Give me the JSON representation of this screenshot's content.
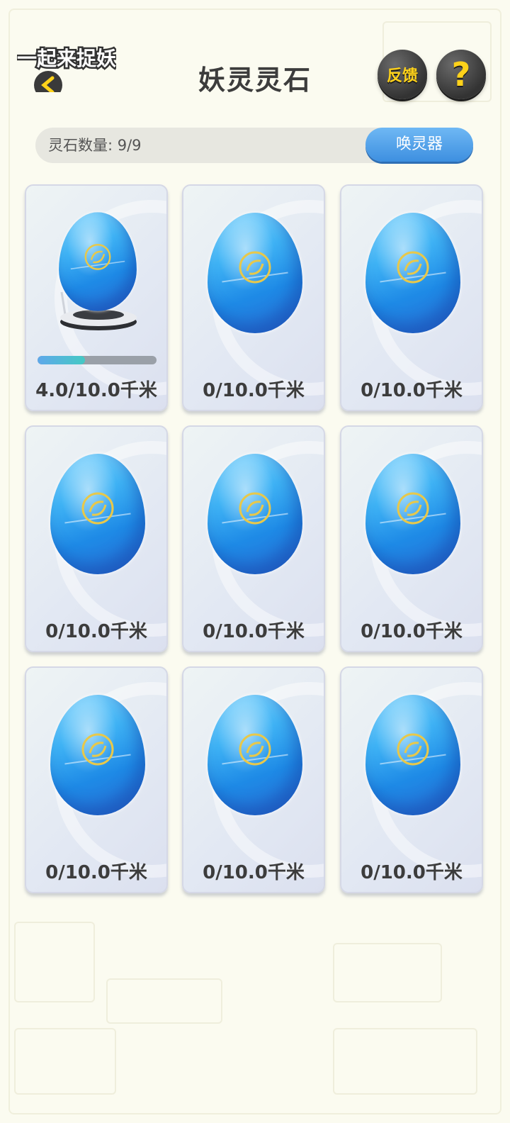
{
  "header": {
    "logo_text": "一起来捉妖",
    "title": "妖灵灵石",
    "feedback_label": "反馈",
    "help_label": "?"
  },
  "count_bar": {
    "label": "灵石数量: 9/9",
    "summon_label": "唤灵器"
  },
  "stones": [
    {
      "distance": "4.0/10.0千米",
      "progress": 0.4,
      "on_incubator": true
    },
    {
      "distance": "0/10.0千米",
      "progress": 0,
      "on_incubator": false
    },
    {
      "distance": "0/10.0千米",
      "progress": 0,
      "on_incubator": false
    },
    {
      "distance": "0/10.0千米",
      "progress": 0,
      "on_incubator": false
    },
    {
      "distance": "0/10.0千米",
      "progress": 0,
      "on_incubator": false
    },
    {
      "distance": "0/10.0千米",
      "progress": 0,
      "on_incubator": false
    },
    {
      "distance": "0/10.0千米",
      "progress": 0,
      "on_incubator": false
    },
    {
      "distance": "0/10.0千米",
      "progress": 0,
      "on_incubator": false
    },
    {
      "distance": "0/10.0千米",
      "progress": 0,
      "on_incubator": false
    }
  ],
  "icons": {
    "back": "back-arrow-icon",
    "stone": "spirit-stone-icon",
    "incubator": "incubator-icon"
  },
  "colors": {
    "accent_blue": "#3d8fe0",
    "gold": "#ffd21a",
    "text_dark": "#3c3c3c"
  }
}
